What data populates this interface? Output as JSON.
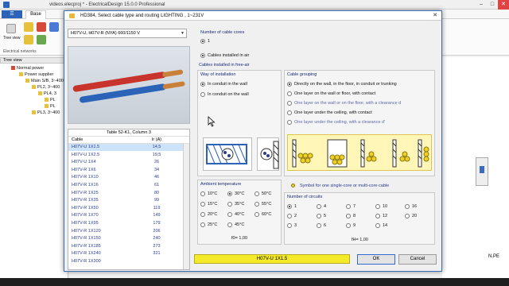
{
  "app": {
    "title": "videos.elecproj * - ElectricalDesign 15.0.0 Professional",
    "tabs": [
      "Base"
    ],
    "ribbon": {
      "tree_view_btn": "Tree view",
      "group_label": "Electrical networks"
    },
    "tree_view_header": "Tree view",
    "tree": [
      "Normal power",
      "Power supplier",
      "Main S/B, 3~400",
      "PL2, 3~400",
      "PL4, 3",
      "PL",
      "PL",
      "PL3, 3~400"
    ],
    "right_text": "N.PE"
  },
  "dialog": {
    "title": "HD384, Select cable type and routing   LIGHTING , 1~231V",
    "cable_type": "H07V-U, H07V-R  (NYA)  660/1150 V",
    "number_of_cores": {
      "title": "Number of cable cores",
      "option": "1"
    },
    "installed_in_air": "Cables installed in air",
    "free_air_title": "Cables installed in free-air",
    "way_of_installation": {
      "title": "Way of installation",
      "options": [
        "In conduit in the wall",
        "In conduit on the wall"
      ],
      "selected": 0
    },
    "cable_grouping": {
      "title": "Cable grouping",
      "options": [
        "Directly on the wall, in the floor, in conduit or trunking",
        "One layer on the wall or floor, with contact",
        "One layer on the wall or on the floor, with a clearance d",
        "One layer under the ceiling, with contact",
        "One layer under the ceiling, with a clearance d'"
      ],
      "selected": 0
    },
    "table": {
      "caption": "Table 52-K1, Column 3",
      "columns": [
        "Cable",
        "Ir (A)"
      ],
      "rows": [
        [
          "H07V-U 1X1.5",
          "14,5"
        ],
        [
          "H07V-U 1X2.5",
          "19,5"
        ],
        [
          "H07V-U 1X4",
          "26"
        ],
        [
          "H07V-R 1X6",
          "34"
        ],
        [
          "H07V-R 1X10",
          "46"
        ],
        [
          "H07V-R 1X16",
          "61"
        ],
        [
          "H07V-R 1X25",
          "80"
        ],
        [
          "H07V-R 1X35",
          "99"
        ],
        [
          "H07V-R 1X50",
          "119"
        ],
        [
          "H07V-R 1X70",
          "149"
        ],
        [
          "H07V-R 1X95",
          "179"
        ],
        [
          "H07V-R 1X120",
          "206"
        ],
        [
          "H07V-R 1X150",
          "240"
        ],
        [
          "H07V-R 1X185",
          "273"
        ],
        [
          "H07V-R 1X240",
          "321"
        ],
        [
          "H07V-R 1X300",
          ""
        ]
      ]
    },
    "ambient": {
      "title": "Ambient temperature",
      "options": [
        "10°C",
        "30°C",
        "50°C",
        "15°C",
        "35°C",
        "55°C",
        "20°C",
        "40°C",
        "60°C",
        "25°C",
        "45°C"
      ],
      "selected": "30°C",
      "factor": "f0= 1,00"
    },
    "symbol_note": "Symbol for one single-core or multi-core cable",
    "circuits": {
      "title": "Number of circuits",
      "options": [
        "1",
        "4",
        "7",
        "10",
        "16",
        "2",
        "5",
        "8",
        "12",
        "20",
        "3",
        "6",
        "9",
        "14"
      ],
      "selected": "1",
      "factor": "fH= 1,00"
    },
    "selected_cable": "H07V-U 1X1.5",
    "ok_label": "OK",
    "cancel_label": "Cancel",
    "colors": {
      "accent": "#2f6bd3",
      "status": "#f4ea2a"
    }
  }
}
